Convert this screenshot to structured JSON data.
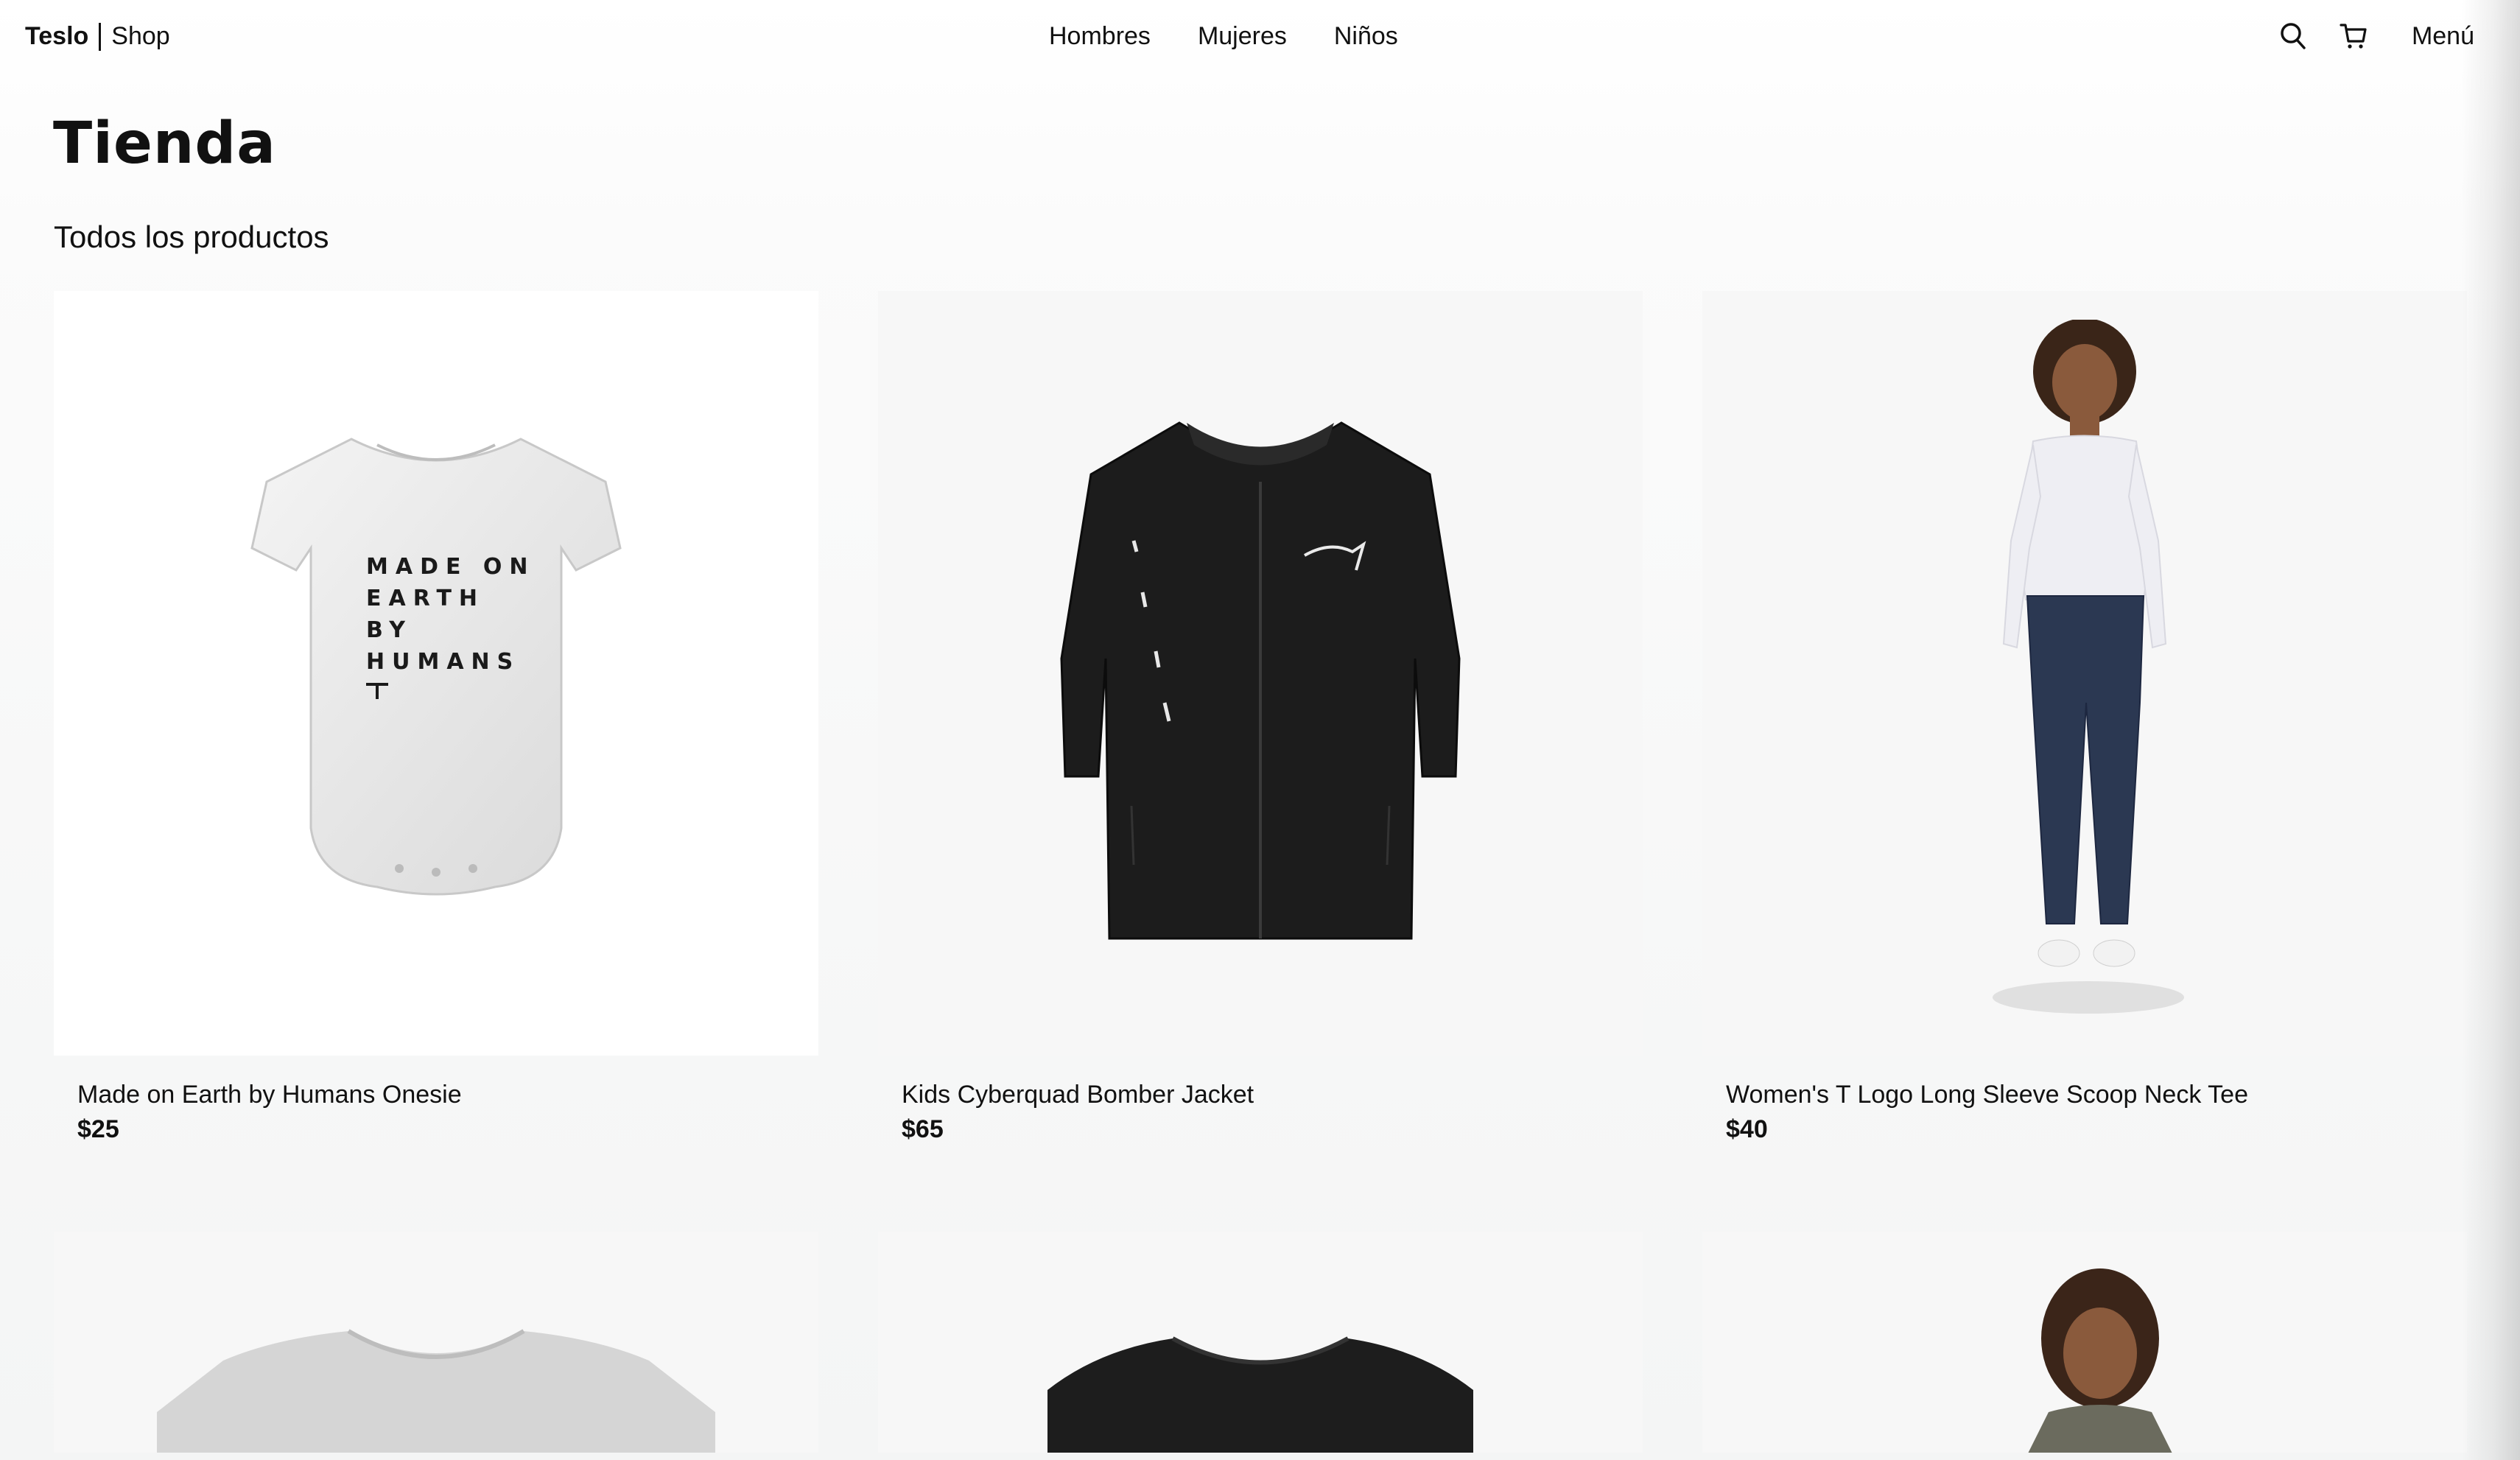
{
  "navbar": {
    "brand_logo": "Teslo",
    "brand_shop": "Shop",
    "links": [
      "Hombres",
      "Mujeres",
      "Niños"
    ],
    "menu_label": "Menú",
    "icons": [
      "search-icon",
      "cart-icon"
    ]
  },
  "page": {
    "title": "Tienda",
    "subtitle": "Todos los productos"
  },
  "products": [
    {
      "title": "Made on Earth by Humans Onesie",
      "price": "$25",
      "image_text": [
        "MADE ON",
        "EARTH",
        "BY",
        "HUMANS"
      ]
    },
    {
      "title": "Kids Cyberquad Bomber Jacket",
      "price": "$65"
    },
    {
      "title": "Women's T Logo Long Sleeve Scoop Neck Tee",
      "price": "$40"
    }
  ],
  "colors": {
    "text": "#111111",
    "card_background": "#f7f7f7",
    "page_background": "#ffffff"
  }
}
